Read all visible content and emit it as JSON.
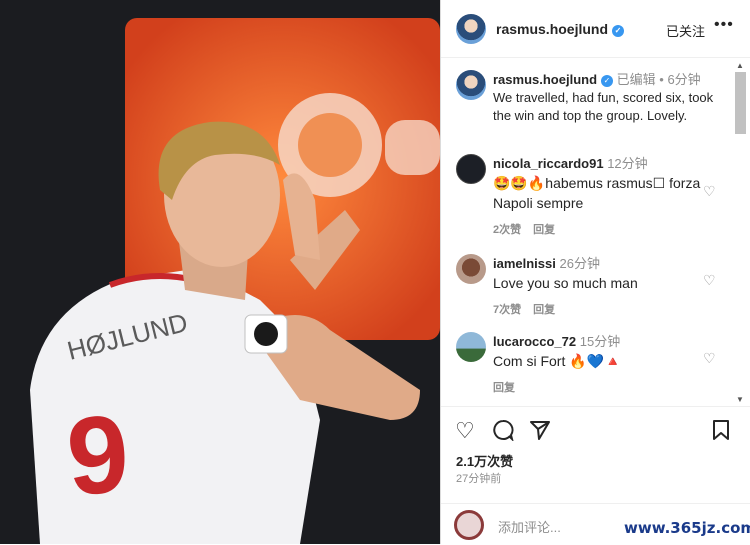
{
  "post": {
    "username": "rasmus.hoejlund",
    "follow_status": "已关注",
    "more_icon": "more-icon"
  },
  "caption": {
    "username": "rasmus.hoejlund",
    "edited": "已编辑",
    "time": "6分钟",
    "text": "We travelled, had fun, scored six, took the win and top the group. Lovely."
  },
  "comments": [
    {
      "username": "nicola_riccardo91",
      "time": "12分钟",
      "text": "🤩🤩🔥habemus rasmus☐ forza Napoli sempre",
      "likes": "2次赞",
      "reply": "回复"
    },
    {
      "username": "iamelnissi",
      "time": "26分钟",
      "text": "Love you so much man",
      "likes": "7次赞",
      "reply": "回复"
    },
    {
      "username": "lucarocco_72",
      "time": "15分钟",
      "text": "Com si Fort 🔥💙🔺",
      "likes": "",
      "reply": "回复"
    }
  ],
  "stats": {
    "likes": "2.1万次赞",
    "posted": "27分钟前"
  },
  "add_comment": {
    "placeholder": "添加评论..."
  },
  "photo": {
    "jersey_number": "9",
    "jersey_name": "HØJLUND"
  },
  "watermark": "www.365jz.com",
  "colors": {
    "accent": "#3897f0",
    "photo_bg": "#1c1c1f",
    "orange_board": "#e8552a"
  }
}
